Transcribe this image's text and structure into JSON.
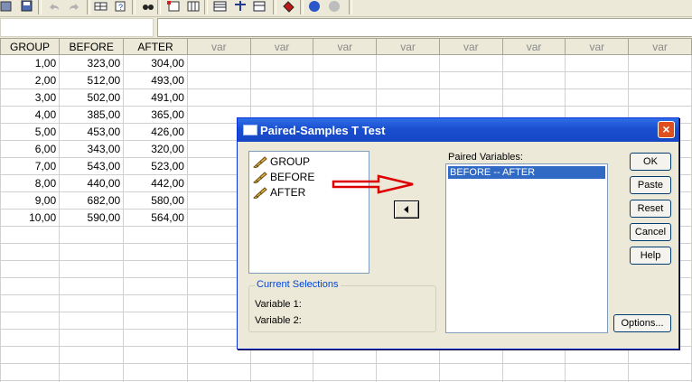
{
  "toolbar": {
    "icons": [
      "open-icon",
      "save-icon",
      "print-icon",
      "undo-icon",
      "redo-icon",
      "goto-case-icon",
      "variables-icon",
      "find-icon",
      "insert-case-icon",
      "insert-variable-icon",
      "split-file-icon",
      "weight-cases-icon",
      "select-cases-icon",
      "value-labels-icon",
      "use-sets-icon",
      "spellcheck-icon"
    ]
  },
  "grid": {
    "columns": [
      "GROUP",
      "BEFORE",
      "AFTER",
      "var",
      "var",
      "var",
      "var",
      "var",
      "var",
      "var",
      "var"
    ],
    "rows": [
      [
        "1,00",
        "323,00",
        "304,00"
      ],
      [
        "2,00",
        "512,00",
        "493,00"
      ],
      [
        "3,00",
        "502,00",
        "491,00"
      ],
      [
        "4,00",
        "385,00",
        "365,00"
      ],
      [
        "5,00",
        "453,00",
        "426,00"
      ],
      [
        "6,00",
        "343,00",
        "320,00"
      ],
      [
        "7,00",
        "543,00",
        "523,00"
      ],
      [
        "8,00",
        "440,00",
        "442,00"
      ],
      [
        "9,00",
        "682,00",
        "580,00"
      ],
      [
        "10,00",
        "590,00",
        "564,00"
      ]
    ],
    "empty_rows": 10
  },
  "dialog": {
    "title": "Paired-Samples T Test",
    "source_variables": [
      "GROUP",
      "BEFORE",
      "AFTER"
    ],
    "paired_label": "Paired Variables:",
    "paired_items": [
      "BEFORE -- AFTER"
    ],
    "current_selections_label": "Current Selections",
    "variable1_label": "Variable 1:",
    "variable2_label": "Variable 2:",
    "buttons": {
      "ok": "OK",
      "paste": "Paste",
      "reset": "Reset",
      "cancel": "Cancel",
      "help": "Help",
      "options": "Options..."
    },
    "close_label": "×"
  },
  "colors": {
    "titlebar": "#1a4fd0",
    "selection": "#316ac5",
    "arrow": "#dd0000",
    "dialog_bg": "#ece9d8"
  }
}
